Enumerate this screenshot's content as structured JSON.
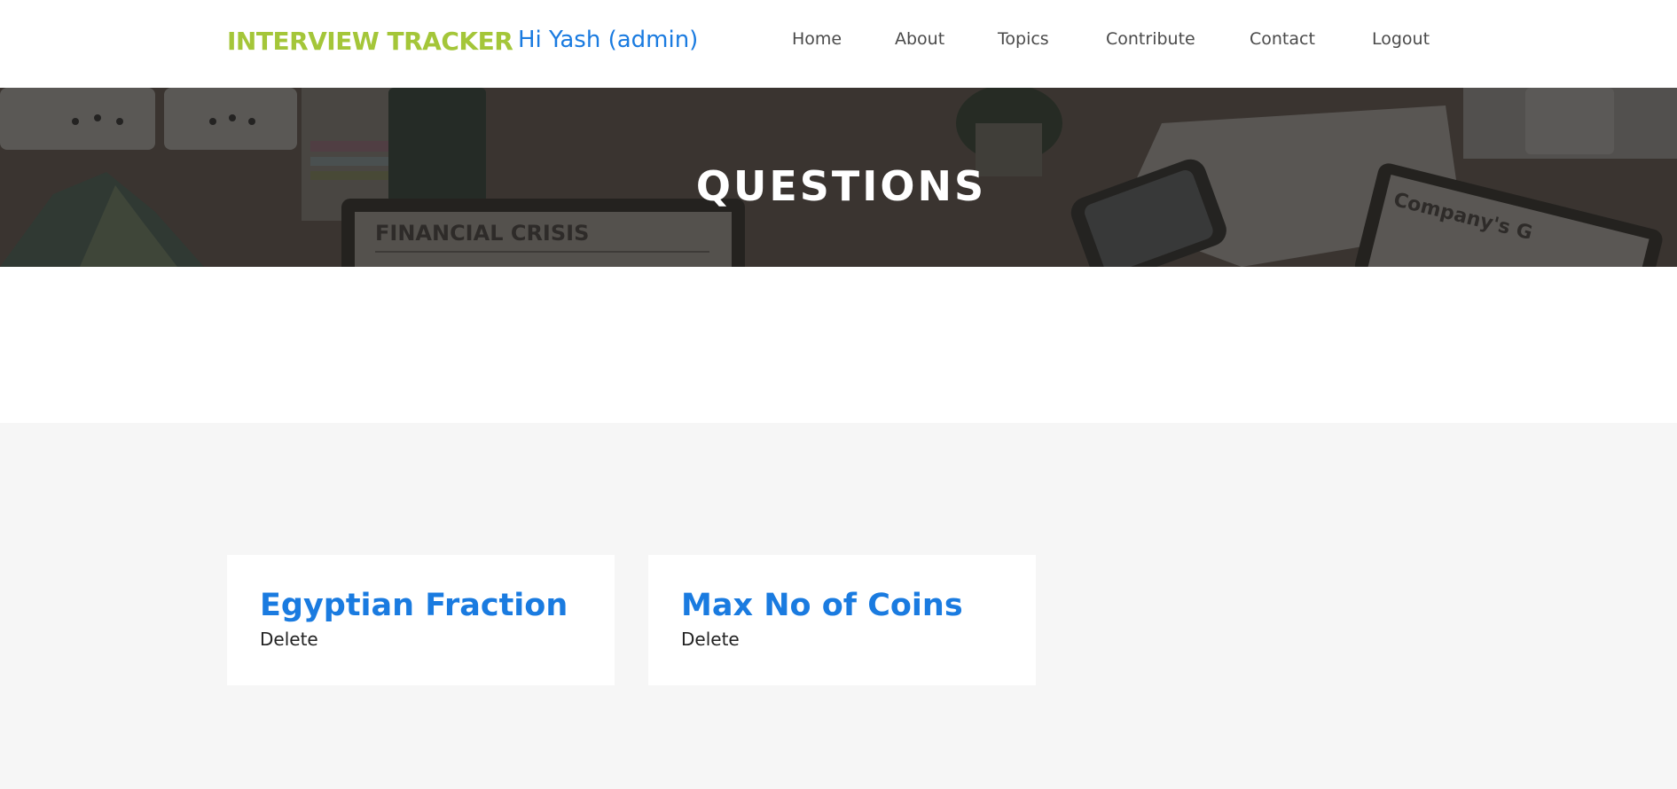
{
  "navbar": {
    "brand": "INTERVIEW TRACKER",
    "greeting": "Hi Yash (admin)",
    "links": [
      "Home",
      "About",
      "Topics",
      "Contribute",
      "Contact",
      "Logout"
    ]
  },
  "hero": {
    "title": "QUESTIONS",
    "background_text": [
      "FINANCIAL CRISIS",
      "Company's G"
    ]
  },
  "questions": [
    {
      "title": "Egyptian Fraction",
      "action": "Delete"
    },
    {
      "title": "Max No of Coins",
      "action": "Delete"
    }
  ],
  "colors": {
    "brand": "#a4c639",
    "accent": "#1a7be0",
    "nav_text": "#4a4a4a",
    "hero_overlay": "#3b3633",
    "section_bg": "#f6f6f6"
  }
}
